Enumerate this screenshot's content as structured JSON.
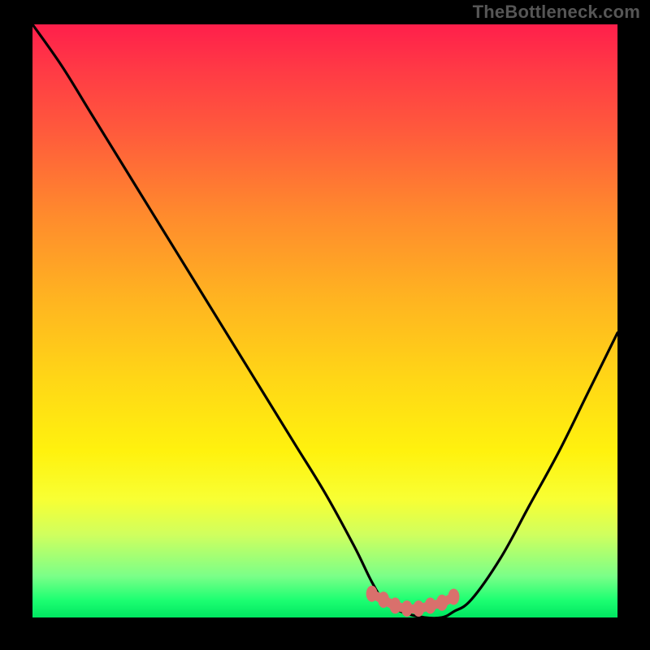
{
  "watermark": "TheBottleneck.com",
  "chart_data": {
    "type": "line",
    "title": "",
    "xlabel": "",
    "ylabel": "",
    "xlim": [
      0,
      100
    ],
    "ylim": [
      0,
      100
    ],
    "series": [
      {
        "name": "bottleneck-curve",
        "x": [
          0,
          5,
          10,
          15,
          20,
          25,
          30,
          35,
          40,
          45,
          50,
          55,
          58,
          60,
          63,
          67,
          70,
          72,
          75,
          80,
          85,
          90,
          95,
          100
        ],
        "values": [
          100,
          93,
          85,
          77,
          69,
          61,
          53,
          45,
          37,
          29,
          21,
          12,
          6,
          3,
          1,
          0,
          0,
          1,
          3,
          10,
          19,
          28,
          38,
          48
        ]
      }
    ],
    "markers": {
      "name": "optimal-range",
      "x": [
        58,
        60,
        62,
        64,
        66,
        68,
        70,
        72
      ],
      "values": [
        4,
        3,
        2,
        1.5,
        1.5,
        2,
        2.5,
        3.5
      ]
    },
    "gradient_stops": [
      {
        "pos": 0.0,
        "color": "#ff1f4b"
      },
      {
        "pos": 0.18,
        "color": "#ff5a3c"
      },
      {
        "pos": 0.46,
        "color": "#ffb321"
      },
      {
        "pos": 0.72,
        "color": "#fff20e"
      },
      {
        "pos": 0.93,
        "color": "#7bff88"
      },
      {
        "pos": 1.0,
        "color": "#00e661"
      }
    ]
  }
}
